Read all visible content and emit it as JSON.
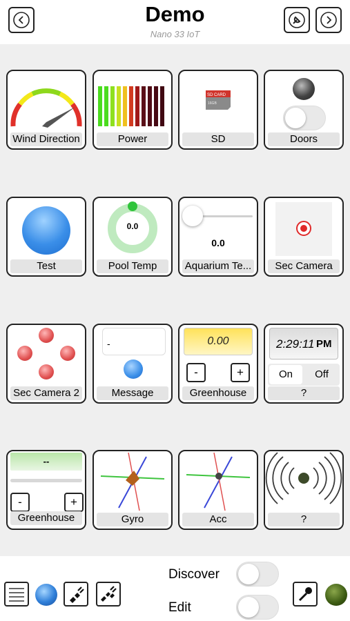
{
  "header": {
    "title": "Demo",
    "subtitle": "Nano 33 IoT"
  },
  "tiles": {
    "wind_direction": {
      "label": "Wind Direction"
    },
    "power": {
      "label": "Power"
    },
    "sd": {
      "label": "SD",
      "card_text": "SD CARD"
    },
    "doors": {
      "label": "Doors",
      "switch_on": false
    },
    "test": {
      "label": "Test"
    },
    "pool_temp": {
      "label": "Pool Temp",
      "value": "0.0"
    },
    "aquarium": {
      "label": "Aquarium Te...",
      "value": "0.0"
    },
    "sec_camera": {
      "label": "Sec Camera"
    },
    "sec_camera_2": {
      "label": "Sec Camera 2"
    },
    "message": {
      "label": "Message",
      "text": "-"
    },
    "greenhouse": {
      "label": "Greenhouse",
      "value": "0.00",
      "minus": "-",
      "plus": "+"
    },
    "clock": {
      "label": "?",
      "time": "2:29:11",
      "ampm": "PM",
      "on_label": "On",
      "off_label": "Off"
    },
    "greenhouse_2": {
      "label": "Greenhouse",
      "value": "--",
      "minus": "-",
      "plus": "+"
    },
    "gyro": {
      "label": "Gyro"
    },
    "acc": {
      "label": "Acc"
    },
    "sound": {
      "label": "?"
    }
  },
  "footer": {
    "discover_label": "Discover",
    "edit_label": "Edit",
    "discover_on": false,
    "edit_on": false
  },
  "colors": {
    "blue_ball": "#3a8ee8",
    "green_led": "#3b5a12",
    "gauge_green": "#8ed81c",
    "gauge_yellow": "#f3e81a",
    "gauge_red": "#e0312a"
  }
}
